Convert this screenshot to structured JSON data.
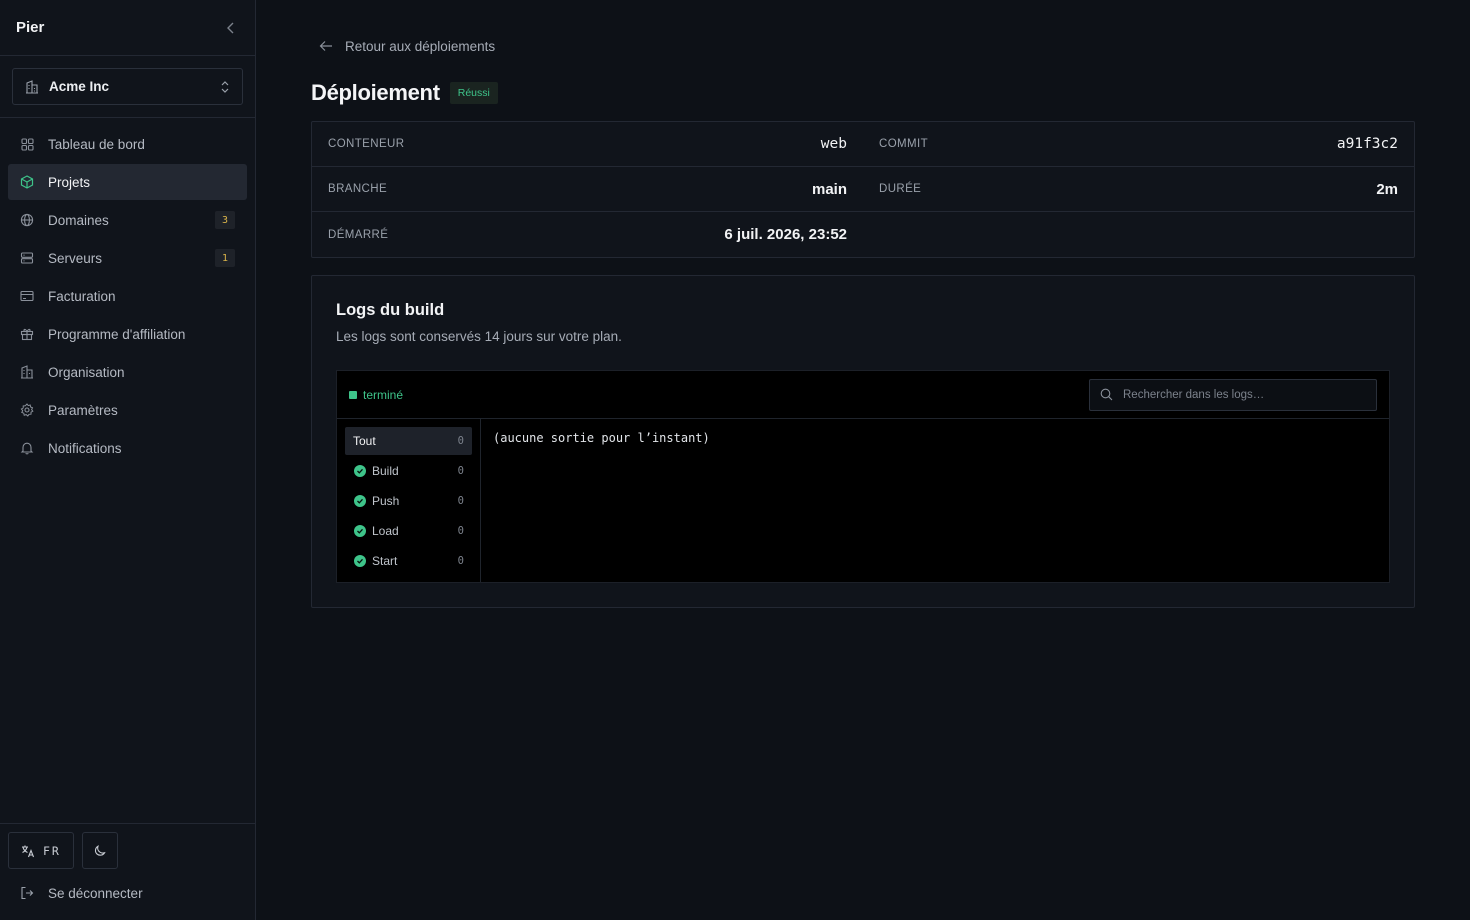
{
  "sidebar": {
    "brand": "Pier",
    "org": {
      "name": "Acme Inc"
    },
    "items": [
      {
        "label": "Tableau de bord",
        "icon": "grid-icon",
        "badge": null
      },
      {
        "label": "Projets",
        "icon": "cube-icon",
        "badge": null,
        "active": true
      },
      {
        "label": "Domaines",
        "icon": "globe-icon",
        "badge": "3"
      },
      {
        "label": "Serveurs",
        "icon": "server-icon",
        "badge": "1"
      },
      {
        "label": "Facturation",
        "icon": "credit-card-icon",
        "badge": null
      },
      {
        "label": "Programme d'affiliation",
        "icon": "gift-icon",
        "badge": null
      },
      {
        "label": "Organisation",
        "icon": "building-icon",
        "badge": null
      },
      {
        "label": "Paramètres",
        "icon": "gear-icon",
        "badge": null
      },
      {
        "label": "Notifications",
        "icon": "bell-icon",
        "badge": null
      }
    ],
    "footer": {
      "lang": "FR",
      "logout": "Se déconnecter"
    }
  },
  "main": {
    "back_label": "Retour aux déploiements",
    "title": "Déploiement",
    "status": "Réussi",
    "info": {
      "container_label": "CONTENEUR",
      "container_value": "web",
      "commit_label": "COMMIT",
      "commit_value": "a91f3c2",
      "branch_label": "BRANCHE",
      "branch_value": "main",
      "duration_label": "DURÉE",
      "duration_value": "2m",
      "started_label": "DÉMARRÉ",
      "started_value": "6 juil. 2026, 23:52"
    },
    "logs": {
      "title": "Logs du build",
      "subtitle": "Les logs sont conservés 14 jours sur votre plan.",
      "status": "terminé",
      "search_placeholder": "Rechercher dans les logs…",
      "steps": [
        {
          "label": "Tout",
          "count": "0"
        },
        {
          "label": "Build",
          "count": "0"
        },
        {
          "label": "Push",
          "count": "0"
        },
        {
          "label": "Load",
          "count": "0"
        },
        {
          "label": "Start",
          "count": "0"
        }
      ],
      "output": "(aucune sortie pour l’instant)"
    }
  },
  "colors": {
    "accent_green": "#3ec48a",
    "badge_yellow": "#d9b44a",
    "background": "#0d1117"
  }
}
